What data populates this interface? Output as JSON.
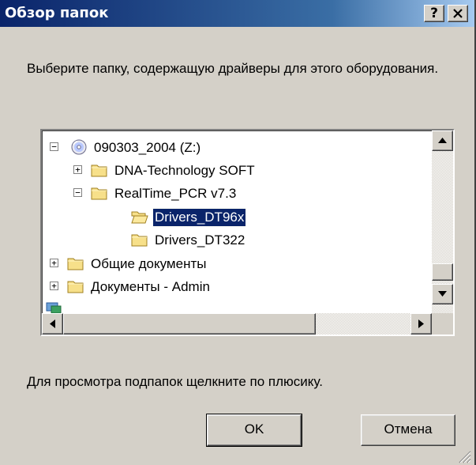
{
  "window": {
    "title": "Обзор папок",
    "help_button": "?",
    "close_button": "✕"
  },
  "prompt": "Выберите папку, содержащую драйверы для этого оборудования.",
  "tree": {
    "items": [
      {
        "label": "090303_2004 (Z:)",
        "icon": "cd-drive-icon",
        "expander": "−"
      },
      {
        "label": "DNA-Technology SOFT",
        "icon": "folder-icon",
        "expander": "+"
      },
      {
        "label": "RealTime_PCR v7.3",
        "icon": "folder-icon",
        "expander": "−"
      },
      {
        "label": "Drivers_DT96x",
        "icon": "folder-open-icon",
        "selected": true
      },
      {
        "label": "Drivers_DT322",
        "icon": "folder-icon"
      },
      {
        "label": "Общие документы",
        "icon": "folder-icon",
        "expander": "+"
      },
      {
        "label": "Документы - Admin",
        "icon": "folder-icon",
        "expander": "+"
      }
    ]
  },
  "hint": "Для просмотра подпапок щелкните по плюсику.",
  "buttons": {
    "ok": "OK",
    "cancel": "Отмена"
  },
  "colors": {
    "titlebar": "#0a246a",
    "selection": "#0a246a",
    "face": "#d4d0c8"
  }
}
